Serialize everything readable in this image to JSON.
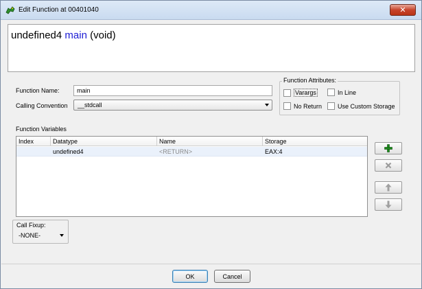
{
  "window": {
    "title": "Edit Function at 00401040",
    "close_glyph": "✕"
  },
  "signature": {
    "return_type": "undefined4",
    "name": "main",
    "params": "(void)"
  },
  "form": {
    "function_name_label": "Function Name:",
    "function_name_value": "main",
    "calling_convention_label": "Calling Convention",
    "calling_convention_value": "__stdcall"
  },
  "attributes": {
    "title": "Function Attributes:",
    "varargs": {
      "label": "Varargs",
      "checked": false
    },
    "inline": {
      "label": "In Line",
      "checked": false
    },
    "no_return": {
      "label": "No Return",
      "checked": false
    },
    "custom_storage": {
      "label": "Use Custom Storage",
      "checked": false
    }
  },
  "variables": {
    "title": "Function Variables",
    "columns": [
      "Index",
      "Datatype",
      "Name",
      "Storage"
    ],
    "rows": [
      {
        "index": "",
        "datatype": "undefined4",
        "name": "<RETURN>",
        "storage": "EAX:4"
      }
    ]
  },
  "side_buttons": {
    "add_icon": "plus-icon",
    "remove_icon": "x-icon",
    "up_icon": "arrow-up-icon",
    "down_icon": "arrow-down-icon",
    "add_color": "#1c8a1c"
  },
  "call_fixup": {
    "label": "Call Fixup:",
    "value": "-NONE-"
  },
  "footer": {
    "ok_label": "OK",
    "cancel_label": "Cancel"
  }
}
